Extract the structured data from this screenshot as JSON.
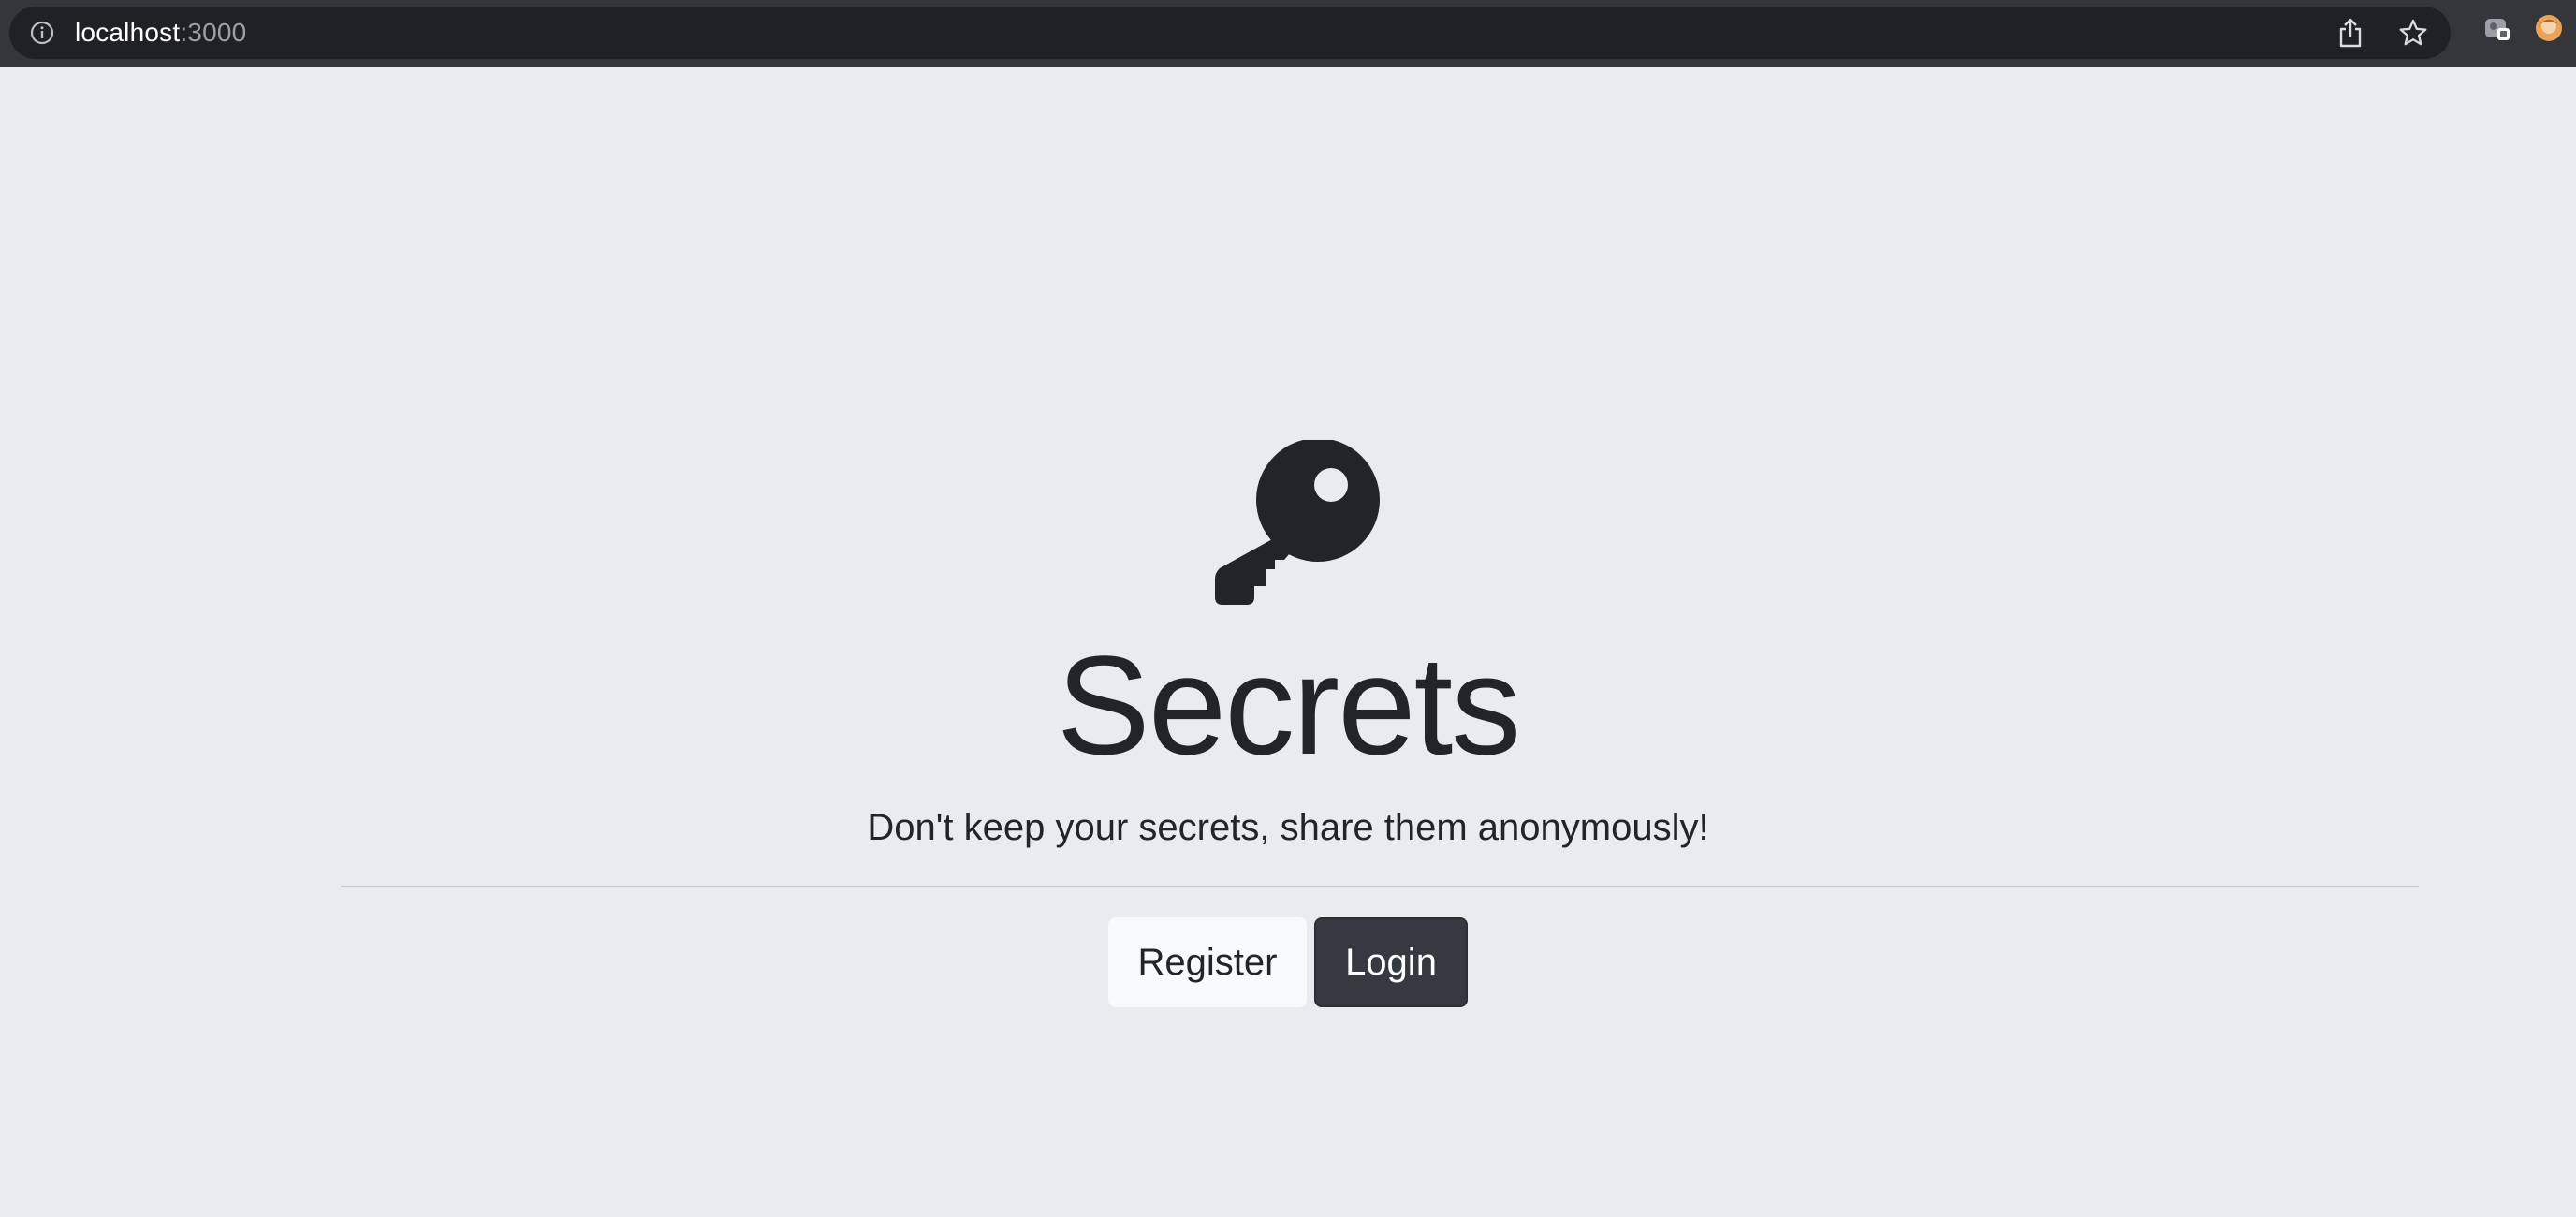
{
  "browser": {
    "url_host": "localhost",
    "url_port": ":3000",
    "icons": {
      "info": "info-icon",
      "share": "share-icon",
      "bookmark": "star-icon",
      "extension": "extension-icon",
      "profile": "profile-avatar-icon"
    }
  },
  "page": {
    "icon": "key-icon",
    "title": "Secrets",
    "subtitle": "Don't keep your secrets, share them anonymously!",
    "buttons": {
      "register_label": "Register",
      "login_label": "Login"
    }
  },
  "colors": {
    "background": "#e8ecef",
    "text": "#212529",
    "button_dark": "#343a40",
    "button_light": "#f8f9fa",
    "chrome_bar": "#35363a",
    "omnibox": "#202124"
  }
}
